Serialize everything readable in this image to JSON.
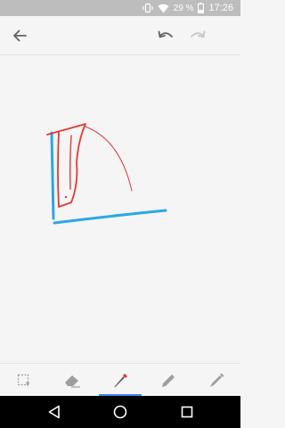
{
  "status_bar": {
    "battery_percent": "29 %",
    "time": "17:26",
    "icons": [
      "vibrate-icon",
      "wifi-icon",
      "battery-icon"
    ]
  },
  "toolbar": {
    "back_icon": "arrow-back-icon",
    "undo_icon": "undo-icon",
    "redo_icon": "redo-icon",
    "redo_enabled": false
  },
  "drawing": {
    "stroke_colors": {
      "red": "#e53935",
      "blue": "#29a8e8"
    }
  },
  "tools": [
    {
      "name": "selection-tool",
      "icon": "selection-icon"
    },
    {
      "name": "eraser-tool",
      "icon": "eraser-icon"
    },
    {
      "name": "pen-tool",
      "icon": "pen-icon",
      "active": true,
      "color": "#e53935"
    },
    {
      "name": "pencil-tool",
      "icon": "pencil-icon"
    },
    {
      "name": "marker-tool",
      "icon": "marker-icon"
    }
  ],
  "colors": {
    "accent": "#4285f4",
    "status_bar": "#bdbdbd",
    "nav_bar": "#000000"
  },
  "nav_bar": {
    "buttons": [
      "back-triangle-icon",
      "home-circle-icon",
      "recents-square-icon"
    ]
  }
}
